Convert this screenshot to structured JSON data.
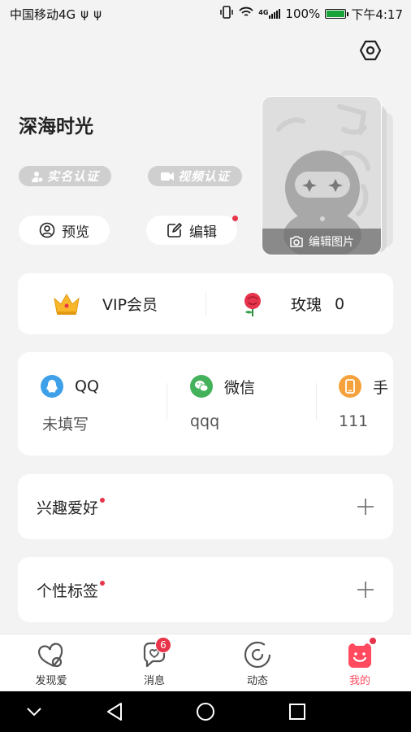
{
  "status_bar": {
    "carrier": "中国移动4G",
    "usb1": "ψ",
    "usb2": "ψ",
    "net_type": "4G",
    "battery": "100%",
    "time": "下午4:17"
  },
  "profile": {
    "name": "深海时光",
    "realname_cert": "实名认证",
    "video_cert": "视频认证",
    "preview_label": "预览",
    "edit_label": "编辑",
    "edit_photo_label": "编辑图片"
  },
  "vip": {
    "vip_label": "VIP会员",
    "rose_label": "玫瑰",
    "rose_count": "0"
  },
  "contacts": [
    {
      "name": "QQ",
      "value": "未填写",
      "color": "#3da0e8"
    },
    {
      "name": "微信",
      "value": "qqq",
      "color": "#43b25a"
    },
    {
      "name": "手",
      "value": "111",
      "color": "#f5a23c"
    }
  ],
  "sections": {
    "hobbies": "兴趣爱好",
    "tags": "个性标签"
  },
  "tabs": [
    {
      "label": "发现爱"
    },
    {
      "label": "消息",
      "badge": "6"
    },
    {
      "label": "动态"
    },
    {
      "label": "我的"
    }
  ],
  "colors": {
    "accent": "#ff4a5f",
    "badge": "#e8344a",
    "background": "#f3f3f3"
  }
}
